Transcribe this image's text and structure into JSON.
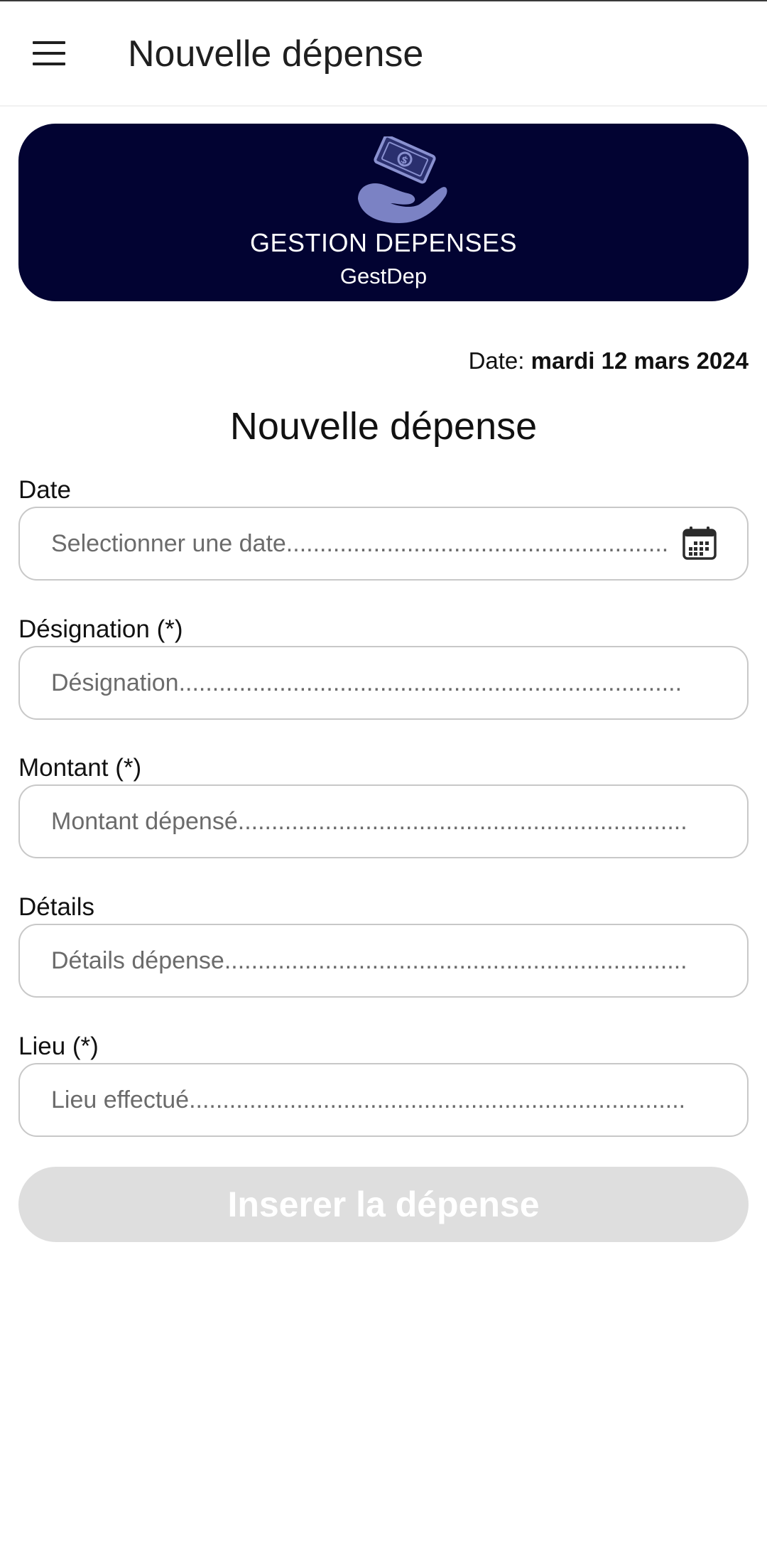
{
  "app_bar": {
    "title": "Nouvelle dépense",
    "menu_icon": "hamburger-menu-icon"
  },
  "banner": {
    "logo_icon": "money-in-hand-icon",
    "title": "GESTION DEPENSES",
    "subtitle": "GestDep",
    "background_color": "#020332",
    "logo_color": "#7b82c4"
  },
  "current_date": {
    "label": "Date:",
    "value": "mardi 12 mars 2024"
  },
  "form": {
    "title": "Nouvelle dépense",
    "fields": {
      "date": {
        "label": "Date",
        "placeholder": "Selectionner une date.........................................................",
        "value": "",
        "icon": "calendar-icon"
      },
      "designation": {
        "label": "Désignation (*)",
        "placeholder": "Désignation...........................................................................",
        "value": ""
      },
      "montant": {
        "label": "Montant (*)",
        "placeholder": "Montant dépensé...................................................................",
        "value": ""
      },
      "details": {
        "label": "Détails",
        "placeholder": "Détails dépense.....................................................................",
        "value": ""
      },
      "lieu": {
        "label": "Lieu (*)",
        "placeholder": "Lieu effectué..........................................................................",
        "value": ""
      }
    },
    "submit_label": "Inserer la dépense",
    "submit_color": "#dedede"
  }
}
